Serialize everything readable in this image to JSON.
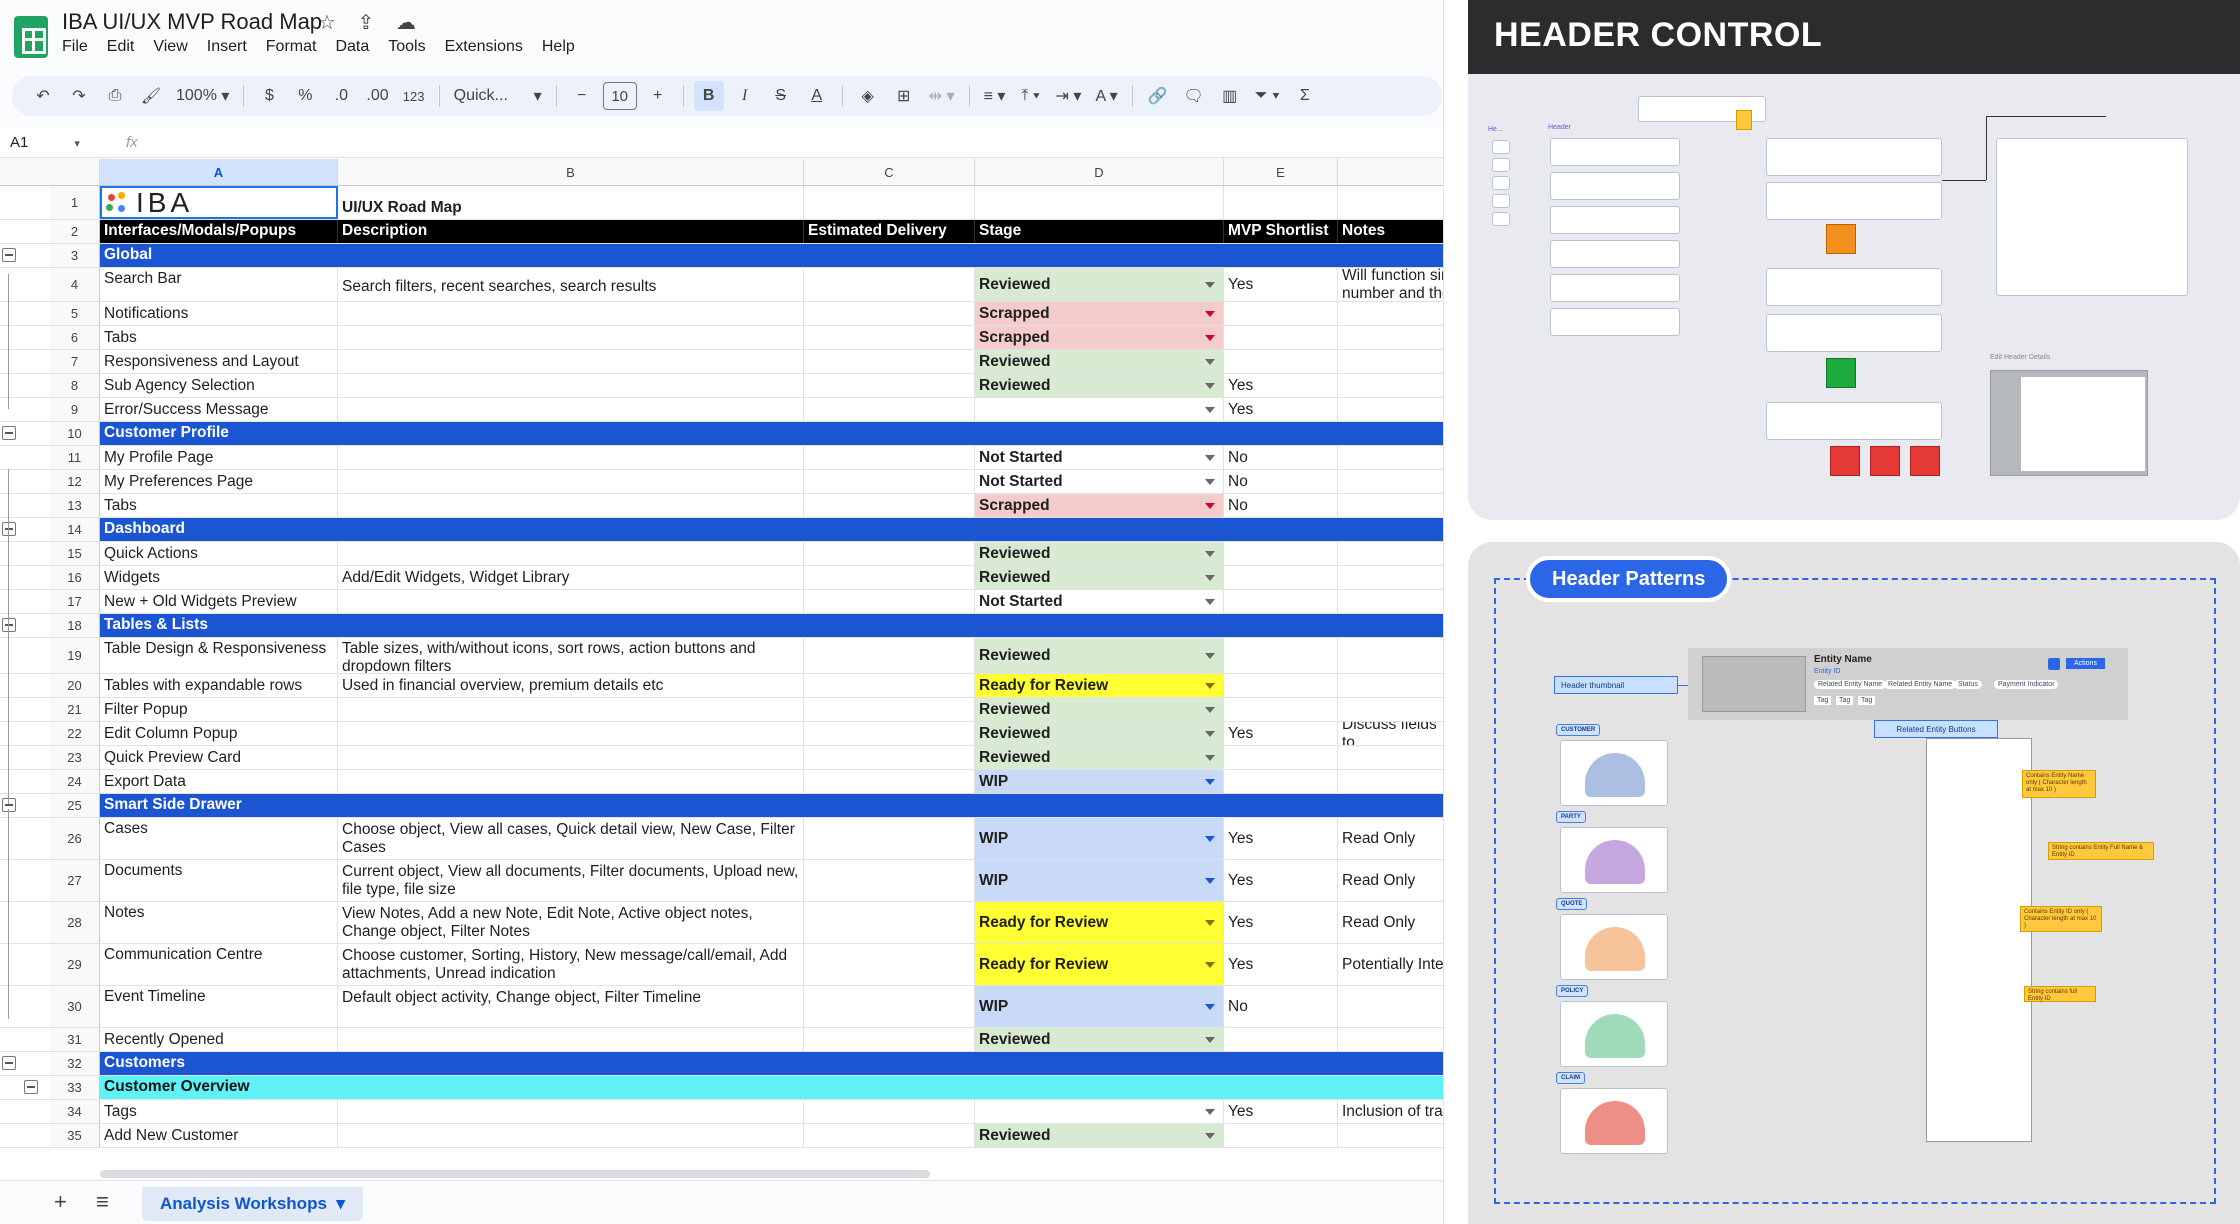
{
  "window": {
    "title": "IBA UI/UX MVP Road Map",
    "menu": [
      "File",
      "Edit",
      "View",
      "Insert",
      "Format",
      "Data",
      "Tools",
      "Extensions",
      "Help"
    ],
    "toolbar": {
      "zoom": "100%",
      "currency": "$",
      "percent": "%",
      "dec_less": ".0",
      "dec_more": ".00",
      "number_format": "123",
      "font": "Quick...",
      "font_size": "10",
      "bold": "B",
      "italic": "I",
      "strike": "S",
      "text_color": "A"
    }
  },
  "formula_bar": {
    "cell_ref": "A1",
    "fx": "fx"
  },
  "columns": [
    "A",
    "B",
    "C",
    "D",
    "E"
  ],
  "header_row": {
    "a": "Interfaces/Modals/Popups",
    "b": "Description",
    "c": "Estimated Delivery",
    "d": "Stage",
    "e": "MVP Shortlist",
    "f": "Notes"
  },
  "row1": {
    "logo": "IBA",
    "b": "UI/UX Road Map"
  },
  "rows": [
    {
      "n": "3",
      "type": "section",
      "a": "Global"
    },
    {
      "n": "4",
      "a": "Search Bar",
      "b": "Search filters, recent searches, search results",
      "d": "Reviewed",
      "e": "Yes",
      "f": "Will function sin number and the"
    },
    {
      "n": "5",
      "a": "Notifications",
      "d": "Scrapped"
    },
    {
      "n": "6",
      "a": "Tabs",
      "d": "Scrapped"
    },
    {
      "n": "7",
      "a": "Responsiveness and Layout",
      "d": "Reviewed"
    },
    {
      "n": "8",
      "a": "Sub Agency Selection",
      "d": "Reviewed",
      "e": "Yes"
    },
    {
      "n": "9",
      "a": "Error/Success Message",
      "d": "",
      "e": "Yes"
    },
    {
      "n": "10",
      "type": "section",
      "a": "Customer Profile"
    },
    {
      "n": "11",
      "a": "My Profile Page",
      "d": "Not Started",
      "e": "No"
    },
    {
      "n": "12",
      "a": "My Preferences Page",
      "d": "Not Started",
      "e": "No"
    },
    {
      "n": "13",
      "a": "Tabs",
      "d": "Scrapped",
      "e": "No"
    },
    {
      "n": "14",
      "type": "section",
      "a": "Dashboard"
    },
    {
      "n": "15",
      "a": "Quick Actions",
      "d": "Reviewed"
    },
    {
      "n": "16",
      "a": "Widgets",
      "b": "Add/Edit Widgets, Widget Library",
      "d": "Reviewed"
    },
    {
      "n": "17",
      "a": "New + Old Widgets Preview",
      "d": "Not Started"
    },
    {
      "n": "18",
      "type": "section",
      "a": "Tables & Lists"
    },
    {
      "n": "19",
      "a": "Table Design & Responsiveness",
      "b": "Table sizes, with/without icons, sort rows, action buttons and dropdown filters",
      "d": "Reviewed"
    },
    {
      "n": "20",
      "a": "Tables with expandable rows",
      "b": "Used in financial overview, premium details etc",
      "d": "Ready for Review"
    },
    {
      "n": "21",
      "a": "Filter Popup",
      "d": "Reviewed"
    },
    {
      "n": "22",
      "a": "Edit Column Popup",
      "d": "Reviewed",
      "e": "Yes",
      "f": "Discuss fields to"
    },
    {
      "n": "23",
      "a": "Quick Preview Card",
      "d": "Reviewed"
    },
    {
      "n": "24",
      "a": "Export Data",
      "d": "WIP"
    },
    {
      "n": "25",
      "type": "section",
      "a": "Smart Side Drawer"
    },
    {
      "n": "26",
      "a": "Cases",
      "b": "Choose object, View all cases, Quick detail view, New Case, Filter Cases",
      "d": "WIP",
      "e": "Yes",
      "f": "Read Only"
    },
    {
      "n": "27",
      "a": "Documents",
      "b": "Current object, View all documents, Filter documents, Upload new, file type, file size",
      "d": "WIP",
      "e": "Yes",
      "f": "Read Only"
    },
    {
      "n": "28",
      "a": "Notes",
      "b": "View Notes, Add a new Note, Edit Note, Active object notes, Change object, Filter Notes",
      "d": "Ready for Review",
      "e": "Yes",
      "f": "Read Only"
    },
    {
      "n": "29",
      "a": "Communication Centre",
      "b": "Choose customer, Sorting, History, New message/call/email, Add attachments, Unread indication",
      "d": "Ready for Review",
      "e": "Yes",
      "f": "Potentially Integ"
    },
    {
      "n": "30",
      "a": "Event Timeline",
      "b": "Default object activity, Change object, Filter Timeline",
      "d": "WIP",
      "e": "No"
    },
    {
      "n": "31",
      "a": "Recently Opened",
      "d": "Reviewed"
    },
    {
      "n": "32",
      "type": "section",
      "a": "Customers"
    },
    {
      "n": "33",
      "type": "sub",
      "a": "Customer Overview"
    },
    {
      "n": "34",
      "a": "Tags",
      "d": "",
      "e": "Yes",
      "f": "Inclusion of traf"
    },
    {
      "n": "35",
      "a": "Add New Customer",
      "d": "Reviewed"
    }
  ],
  "sheet_tabs": [
    {
      "label": "Analysis Workshops"
    }
  ],
  "panel_header_control": {
    "title": "HEADER CONTROL",
    "frame_label": "Header",
    "frame_label_small": "He...",
    "edit_label": "Edit Header Details"
  },
  "panel_header_patterns": {
    "title": "Header Patterns",
    "header_thumbnail": "Header thumbnail",
    "entity_name": "Entity Name",
    "entity_id": "Entity ID",
    "chips": [
      "Related Entity Name",
      "Related Entity Name",
      "Status",
      "Payment Indicator"
    ],
    "tags": [
      "Tag",
      "Tag",
      "Tag"
    ],
    "actions": "Actions",
    "related_entity_buttons": "Related Entity Buttons",
    "categories": [
      "CUSTOMER",
      "PARTY",
      "QUOTE",
      "POLICY",
      "CLAIM"
    ],
    "notes": [
      "Contains Entity Name only ( Character length at max 10 )",
      "String contains Entity Full Name & Entity ID",
      "Contains Entity ID only ( Character length at max 10 )",
      "String contains full Entity ID"
    ]
  }
}
